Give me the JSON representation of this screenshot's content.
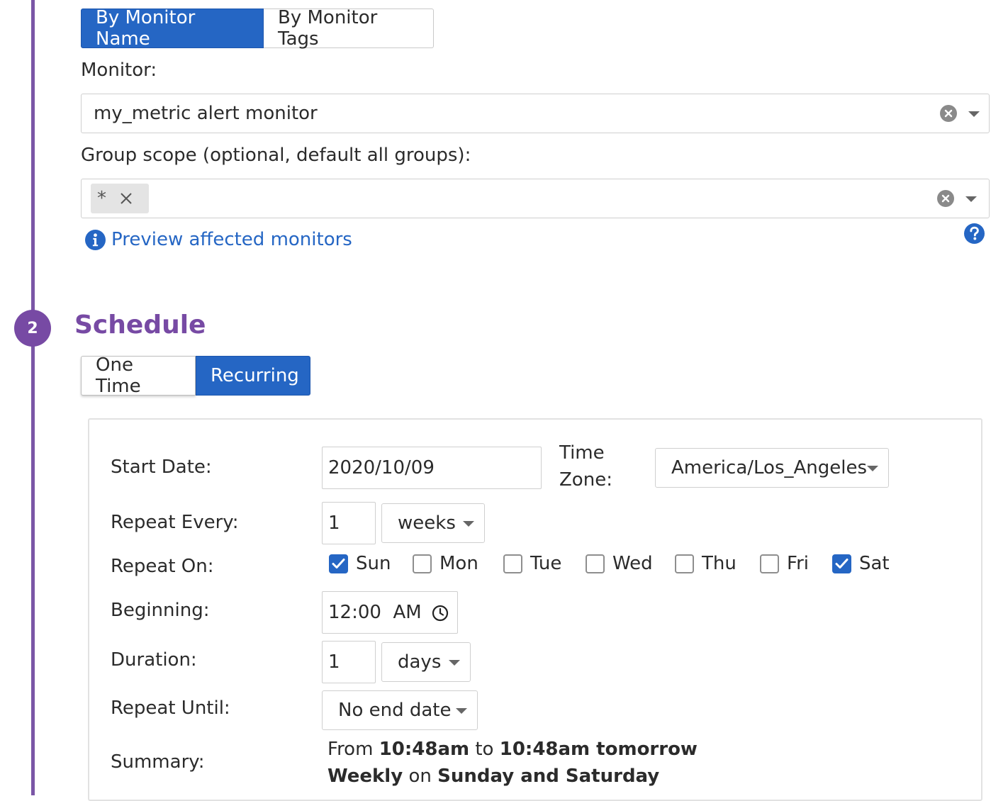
{
  "target_tabs": [
    {
      "label": "By Monitor Name",
      "active": true
    },
    {
      "label": "By Monitor Tags",
      "active": false
    }
  ],
  "monitor": {
    "label": "Monitor:",
    "value": "my_metric alert monitor"
  },
  "group_scope": {
    "label": "Group scope (optional, default all groups):",
    "tag": "*"
  },
  "preview_link": "Preview affected monitors",
  "schedule": {
    "step_number": "2",
    "title": "Schedule",
    "tabs": [
      {
        "label": "One Time",
        "active": false
      },
      {
        "label": "Recurring",
        "active": true
      }
    ]
  },
  "form": {
    "start_date_label": "Start Date:",
    "start_date_value": "2020/10/09",
    "time_zone_label_line1": "Time",
    "time_zone_label_line2": "Zone:",
    "time_zone_value": "America/Los_Angeles",
    "repeat_every_label": "Repeat Every:",
    "repeat_every_value": "1",
    "repeat_every_unit": "weeks",
    "repeat_on_label": "Repeat On:",
    "days": [
      {
        "label": "Sun",
        "checked": true
      },
      {
        "label": "Mon",
        "checked": false
      },
      {
        "label": "Tue",
        "checked": false
      },
      {
        "label": "Wed",
        "checked": false
      },
      {
        "label": "Thu",
        "checked": false
      },
      {
        "label": "Fri",
        "checked": false
      },
      {
        "label": "Sat",
        "checked": true
      }
    ],
    "beginning_label": "Beginning:",
    "beginning_value": "12:00  AM",
    "duration_label": "Duration:",
    "duration_value": "1",
    "duration_unit": "days",
    "repeat_until_label": "Repeat Until:",
    "repeat_until_value": "No end date",
    "summary_label": "Summary:",
    "summary": {
      "from_word": "From",
      "start_time": "10:48am",
      "to_word": "to",
      "end_time": "10:48am tomorrow",
      "frequency": "Weekly",
      "on_word": "on",
      "days_text": "Sunday and Saturday"
    }
  },
  "colors": {
    "accent_blue": "#2566c4",
    "step_purple": "#774aa4",
    "heading_purple": "#774aa4"
  },
  "icons": [
    "info-icon",
    "help-icon",
    "clear-icon",
    "dropdown-caret-icon",
    "remove-tag-icon",
    "clock-icon",
    "checkmark-icon"
  ]
}
